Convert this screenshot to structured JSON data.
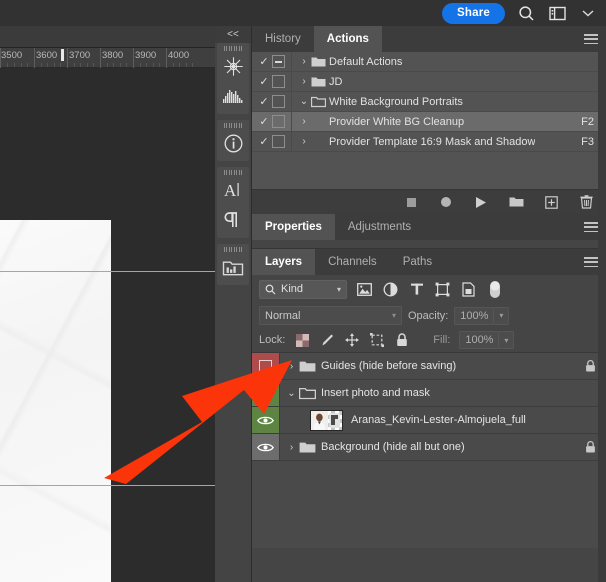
{
  "topbar": {
    "share_label": "Share",
    "icons": [
      "search-icon",
      "workspace-icon",
      "chevron-down-icon"
    ]
  },
  "canvas": {
    "ruler_unit_labels": [
      "3500",
      "3600",
      "3700",
      "3800",
      "3900",
      "4000"
    ],
    "guide_color": "#19e0e8",
    "background_color": "#2c2c2c"
  },
  "icon_rail": {
    "collapse_label": "<<",
    "items": [
      {
        "name": "adjustments-icon",
        "title": "Adjustments"
      },
      {
        "name": "histogram-icon",
        "title": "Histogram"
      },
      {
        "name": "info-icon",
        "title": "Info"
      },
      {
        "name": "character-icon",
        "title": "Character"
      },
      {
        "name": "paragraph-icon",
        "title": "Paragraph"
      },
      {
        "name": "libraries-icon",
        "title": "Libraries"
      }
    ]
  },
  "actions_panel": {
    "tabs": [
      {
        "label": "History",
        "active": false
      },
      {
        "label": "Actions",
        "active": true
      }
    ],
    "rows": [
      {
        "check": "✓",
        "toggle": "dash",
        "arrow": "›",
        "folder": true,
        "label": "Default Actions",
        "key": "",
        "selected": false,
        "expanded": false
      },
      {
        "check": "✓",
        "toggle": "blank",
        "arrow": "›",
        "folder": true,
        "label": "JD",
        "key": "",
        "selected": false,
        "expanded": false
      },
      {
        "check": "✓",
        "toggle": "blank",
        "arrow": "⌄",
        "folder": true,
        "label": "White Background Portraits",
        "key": "",
        "selected": false,
        "expanded": true
      },
      {
        "check": "✓",
        "toggle": "blank",
        "arrow": "›",
        "folder": false,
        "label": "Provider White BG Cleanup",
        "key": "F2",
        "selected": true,
        "expanded": false
      },
      {
        "check": "✓",
        "toggle": "blank",
        "arrow": "›",
        "folder": false,
        "label": "Provider Template 16:9 Mask and Shadow",
        "key": "F3",
        "selected": false,
        "expanded": false
      }
    ],
    "toolbar_icons": [
      "stop-icon",
      "record-icon",
      "play-icon",
      "new-set-icon",
      "new-action-icon",
      "delete-icon"
    ]
  },
  "properties_panel": {
    "tabs": [
      {
        "label": "Properties",
        "active": true
      },
      {
        "label": "Adjustments",
        "active": false
      }
    ]
  },
  "layers_panel": {
    "tabs": [
      {
        "label": "Layers",
        "active": true
      },
      {
        "label": "Channels",
        "active": false
      },
      {
        "label": "Paths",
        "active": false
      }
    ],
    "filter": {
      "kind_label": "Kind",
      "icons": [
        "pixel-filter-icon",
        "adjustment-filter-icon",
        "type-filter-icon",
        "shape-filter-icon",
        "smart-object-filter-icon",
        "filter-toggle-icon"
      ]
    },
    "blend": {
      "mode": "Normal",
      "opacity_label": "Opacity:",
      "opacity_value": "100%"
    },
    "lock": {
      "lock_label": "Lock:",
      "icons": [
        "lock-transparent-icon",
        "lock-image-icon",
        "lock-position-icon",
        "lock-artboard-icon",
        "lock-all-icon"
      ],
      "fill_label": "Fill:",
      "fill_value": "100%"
    },
    "layers": [
      {
        "name": "Guides (hide before saving)",
        "visible": false,
        "vis_state": "red",
        "type": "group",
        "arrow": "›",
        "locked": true,
        "expanded": false,
        "indent": 0
      },
      {
        "name": "Insert photo and mask",
        "visible": true,
        "vis_state": "green",
        "type": "group",
        "arrow": "⌄",
        "locked": false,
        "expanded": true,
        "indent": 0
      },
      {
        "name": "Aranas_Kevin-Lester-Almojuela_full",
        "visible": true,
        "vis_state": "green",
        "type": "layer",
        "arrow": "",
        "locked": false,
        "expanded": false,
        "indent": 1
      },
      {
        "name": "Background (hide all but one)",
        "visible": true,
        "vis_state": "gray",
        "type": "group",
        "arrow": "›",
        "locked": true,
        "expanded": false,
        "indent": 0
      }
    ]
  },
  "annotation": {
    "arrow_color": "#fb3409",
    "points_to": "Guides layer visibility toggle"
  }
}
